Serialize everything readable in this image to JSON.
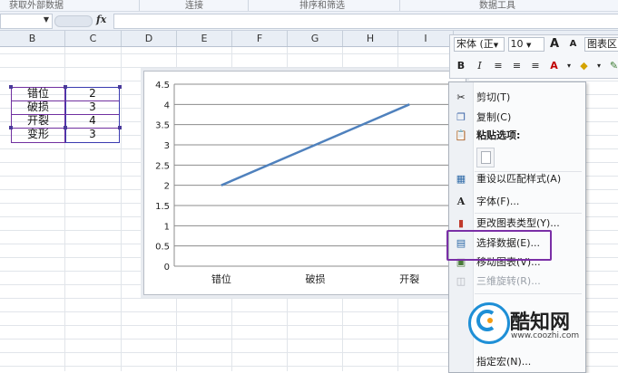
{
  "ribbon": {
    "groups": [
      "获取外部数据",
      "连接",
      "排序和筛选",
      "数据工具"
    ]
  },
  "formula_bar": {
    "name_box": "",
    "fx_label": "fx",
    "value": ""
  },
  "columns": [
    "B",
    "C",
    "D",
    "E",
    "F",
    "G",
    "H",
    "I"
  ],
  "table": {
    "rows": [
      {
        "label": "错位",
        "value": "2"
      },
      {
        "label": "破损",
        "value": "3"
      },
      {
        "label": "开裂",
        "value": "4"
      },
      {
        "label": "变形",
        "value": "3"
      }
    ]
  },
  "chart_data": {
    "type": "line",
    "categories": [
      "错位",
      "破损",
      "开裂"
    ],
    "series": [
      {
        "values": [
          2,
          3,
          4
        ]
      }
    ],
    "ylim": [
      0,
      4.5
    ],
    "y_ticks": [
      "0",
      "0.5",
      "1",
      "1.5",
      "2",
      "2.5",
      "3",
      "3.5",
      "4",
      "4.5"
    ],
    "grid": true,
    "line_color": "#4f81bd"
  },
  "mini_toolbar": {
    "font_name": "宋体 (正",
    "font_size": "10",
    "grow_font": "A",
    "shrink_font": "A",
    "chart_area": "图表区",
    "bold": "B",
    "italic": "I"
  },
  "context_menu": {
    "items": [
      {
        "label": "剪切(T)",
        "icon": "scissors-icon",
        "disabled": false
      },
      {
        "label": "复制(C)",
        "icon": "copy-icon",
        "disabled": false
      },
      {
        "label": "粘贴选项:",
        "icon": "paste-icon",
        "disabled": false
      },
      {
        "label": "重设以匹配样式(A)",
        "icon": "reset-style-icon",
        "disabled": false
      },
      {
        "label": "字体(F)...",
        "icon": "font-icon",
        "disabled": false
      },
      {
        "label": "更改图表类型(Y)...",
        "icon": "chart-type-icon",
        "disabled": false
      },
      {
        "label": "选择数据(E)...",
        "icon": "select-data-icon",
        "disabled": false
      },
      {
        "label": "移动图表(V)...",
        "icon": "move-chart-icon",
        "disabled": false
      },
      {
        "label": "三维旋转(R)...",
        "icon": "rotate-3d-icon",
        "disabled": true
      },
      {
        "label": "指定宏(N)...",
        "icon": "",
        "disabled": false
      }
    ]
  },
  "watermark": {
    "brand": "酷知网",
    "url": "www.coozhi.com"
  },
  "colors": {
    "highlight_box": "#7a2fa6",
    "selection_handles": "#4a3a9a"
  }
}
